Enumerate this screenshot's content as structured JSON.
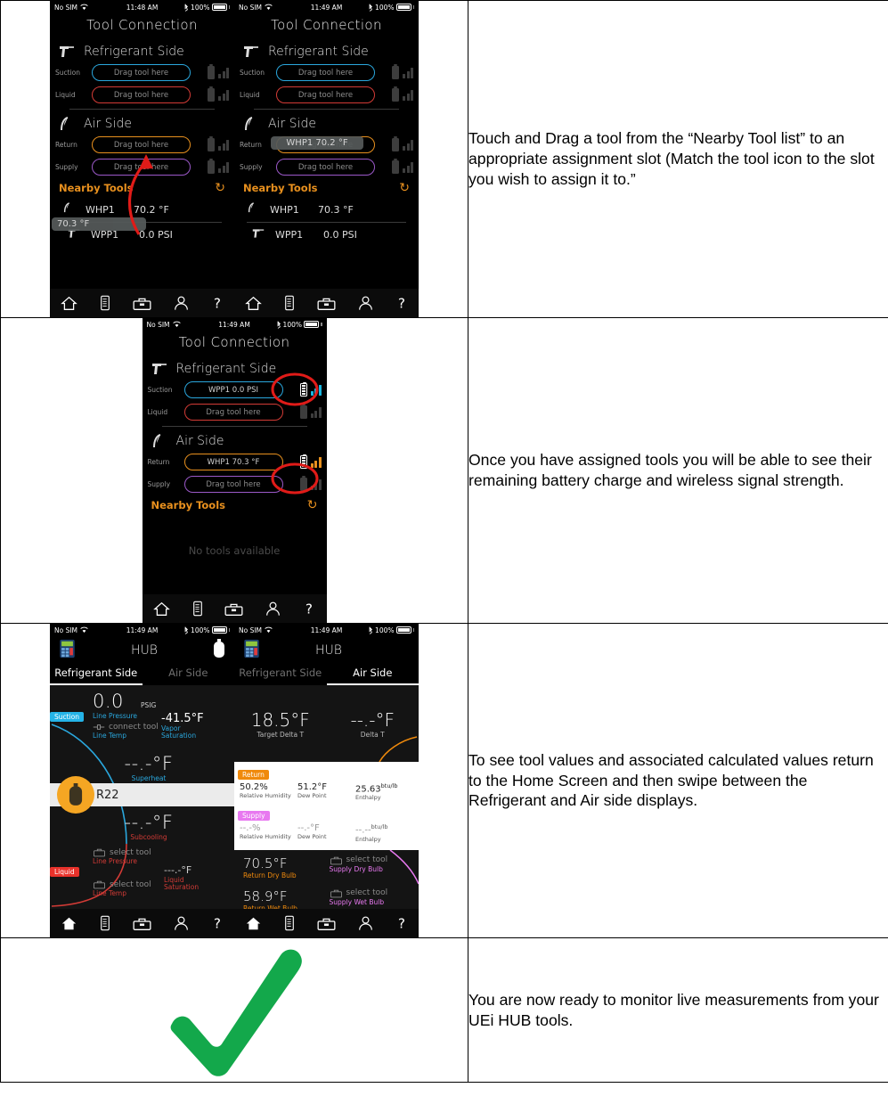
{
  "document": {
    "rows": [
      {
        "caption": "Touch and Drag a tool from the “Nearby Tool list” to an appropriate assignment slot (Match the tool icon to the slot you wish to assign it to.”"
      },
      {
        "caption": "Once you have assigned tools you will be able to see their remaining battery charge and wireless signal strength."
      },
      {
        "caption": "To see tool values and associated calculated values return to the Home Screen and then swipe between the Refrigerant and Air side displays."
      },
      {
        "caption": "You are now ready to monitor live measurements from your UEi HUB tools."
      }
    ]
  },
  "screens": {
    "tool_connection_drag": {
      "status": {
        "carrier": "No SIM",
        "wifi_icon": "wifi-icon",
        "time": "11:48 AM",
        "bluetooth_icon": "bluetooth-icon",
        "battery_pct": "100%"
      },
      "nav_title": "Tool Connection",
      "refrigerant": {
        "heading": "Refrigerant Side",
        "icon": "pressure-probe-icon",
        "slots": [
          {
            "label": "Suction",
            "value": "Drag tool here",
            "color": "#2aa7dd",
            "filled": false
          },
          {
            "label": "Liquid",
            "value": "Drag tool here",
            "color": "#d33b36",
            "filled": false
          }
        ]
      },
      "air": {
        "heading": "Air Side",
        "icon": "air-probe-icon",
        "slots": [
          {
            "label": "Return",
            "value": "Drag tool here",
            "color": "#e8901e",
            "filled": false
          },
          {
            "label": "Supply",
            "value": "Drag tool here",
            "color": "#9b59c9",
            "filled": false
          }
        ]
      },
      "nearby": {
        "title": "Nearby Tools",
        "refresh_icon": "refresh-icon",
        "tools": [
          {
            "icon": "air-probe-icon",
            "name": "WHP1",
            "value": "70.2 °F"
          },
          {
            "icon": "pressure-probe-icon",
            "name": "WPP1",
            "value": "0.0 PSI"
          }
        ]
      },
      "drag_ghost": {
        "value": "70.3 °F",
        "icon": "air-probe-icon"
      },
      "annotation": {
        "type": "red-arrow",
        "color": "#e01b18"
      },
      "tabbar": [
        "home-icon",
        "gauge-icon",
        "toolbox-icon",
        "account-icon",
        "help-icon"
      ]
    },
    "tool_connection_drop": {
      "status": {
        "carrier": "No SIM",
        "wifi_icon": "wifi-icon",
        "time": "11:49 AM",
        "bluetooth_icon": "bluetooth-icon",
        "battery_pct": "100%"
      },
      "nav_title": "Tool Connection",
      "refrigerant": {
        "heading": "Refrigerant Side",
        "icon": "pressure-probe-icon",
        "slots": [
          {
            "label": "Suction",
            "value": "Drag tool here",
            "color": "#2aa7dd",
            "filled": false
          },
          {
            "label": "Liquid",
            "value": "Drag tool here",
            "color": "#d33b36",
            "filled": false
          }
        ]
      },
      "air": {
        "heading": "Air Side",
        "icon": "air-probe-icon",
        "slots": [
          {
            "label": "Return",
            "value": "Drag tool here",
            "overlay": "WHP1 70.2 °F",
            "color": "#e8901e",
            "filled": true
          },
          {
            "label": "Supply",
            "value": "Drag tool here",
            "color": "#9b59c9",
            "filled": false
          }
        ]
      },
      "nearby": {
        "title": "Nearby Tools",
        "refresh_icon": "refresh-icon",
        "tools": [
          {
            "icon": "air-probe-icon",
            "name": "WHP1",
            "value": "70.3 °F"
          },
          {
            "icon": "pressure-probe-icon",
            "name": "WPP1",
            "value": "0.0 PSI"
          }
        ]
      },
      "tabbar": [
        "home-icon",
        "gauge-icon",
        "toolbox-icon",
        "account-icon",
        "help-icon"
      ]
    },
    "tool_connection_assigned": {
      "status": {
        "carrier": "No SIM",
        "wifi_icon": "wifi-icon",
        "time": "11:49 AM",
        "bluetooth_icon": "bluetooth-icon",
        "battery_pct": "100%"
      },
      "nav_title": "Tool Connection",
      "refrigerant": {
        "heading": "Refrigerant Side",
        "icon": "pressure-probe-icon",
        "slots": [
          {
            "label": "Suction",
            "value": "WPP1  0.0 PSI",
            "color": "#2aa7dd",
            "filled": true,
            "battery": true,
            "signal": "cyan"
          },
          {
            "label": "Liquid",
            "value": "Drag tool here",
            "color": "#d33b36",
            "filled": false,
            "battery": false,
            "signal": "off"
          }
        ]
      },
      "air": {
        "heading": "Air Side",
        "icon": "air-probe-icon",
        "slots": [
          {
            "label": "Return",
            "value": "WHP1  70.3 °F",
            "color": "#e8901e",
            "filled": true,
            "battery": true,
            "signal": "orange"
          },
          {
            "label": "Supply",
            "value": "Drag tool here",
            "color": "#9b59c9",
            "filled": false,
            "battery": false,
            "signal": "off"
          }
        ]
      },
      "nearby": {
        "title": "Nearby Tools",
        "refresh_icon": "refresh-icon",
        "empty_text": "No tools available",
        "tools": []
      },
      "annotation": {
        "type": "red-circles",
        "color": "#e01b18"
      },
      "tabbar": [
        "home-icon",
        "gauge-icon",
        "toolbox-icon",
        "account-icon",
        "help-icon"
      ]
    },
    "hub_refrigerant": {
      "status": {
        "carrier": "No SIM",
        "wifi_icon": "wifi-icon",
        "time": "11:49 AM",
        "bluetooth_icon": "bluetooth-icon",
        "battery_pct": "100%"
      },
      "header": {
        "left_icon": "manifold-icon",
        "title": "HUB",
        "right_icon": "tank-icon"
      },
      "tabs": [
        {
          "label": "Refrigerant Side",
          "active": true
        },
        {
          "label": "Air Side",
          "active": false
        }
      ],
      "suction_tag": "Suction",
      "liquid_tag": "Liquid",
      "refrigerant_label": "R22",
      "readouts": [
        {
          "value": "0.0",
          "unit": "PSIG",
          "label": "Line Pressure",
          "color": "#2aa7dd"
        },
        {
          "value": "-41.5°F",
          "label": "Vapor Saturation",
          "color": "#2aa7dd"
        },
        {
          "value": "connect tool",
          "label": "Line Temp",
          "color": "#2aa7dd",
          "placeholder": true
        },
        {
          "value": "--.-°F",
          "label": "Superheat",
          "color": "#2aa7dd"
        },
        {
          "value": "--.-°F",
          "label": "Subcooling",
          "color": "#d33b36"
        },
        {
          "value": "select tool",
          "label": "Line Pressure",
          "color": "#d33b36",
          "placeholder": true
        },
        {
          "value": "---.-°F",
          "label": "Liquid Saturation",
          "color": "#d33b36"
        },
        {
          "value": "select tool",
          "label": "Line Temp",
          "color": "#d33b36",
          "placeholder": true
        }
      ],
      "tabbar": [
        "home-icon",
        "gauge-icon",
        "toolbox-icon",
        "account-icon",
        "help-icon"
      ]
    },
    "hub_air": {
      "status": {
        "carrier": "No SIM",
        "wifi_icon": "wifi-icon",
        "time": "11:49 AM",
        "bluetooth_icon": "bluetooth-icon",
        "battery_pct": "100%"
      },
      "header": {
        "left_icon": "manifold-icon",
        "title": "HUB",
        "right_icon": ""
      },
      "tabs": [
        {
          "label": "Refrigerant Side",
          "active": false
        },
        {
          "label": "Air Side",
          "active": true
        }
      ],
      "delta": [
        {
          "value": "18.5°F",
          "label": "Target Delta T"
        },
        {
          "value": "--.-°F",
          "label": "Delta T"
        }
      ],
      "return_tag": "Return",
      "return_row": [
        {
          "value": "50.2%",
          "label": "Relative Humidity"
        },
        {
          "value": "51.2°F",
          "label": "Dew Point"
        },
        {
          "value": "25.63",
          "unit": "btu/lb",
          "label": "Enthalpy"
        }
      ],
      "supply_tag": "Supply",
      "supply_row": [
        {
          "value": "--.-%",
          "label": "Relative Humidity"
        },
        {
          "value": "--.-°F",
          "label": "Dew Point"
        },
        {
          "value": "--.--",
          "unit": "btu/lb",
          "label": "Enthalpy"
        }
      ],
      "bulbs": [
        {
          "value": "70.5°F",
          "label": "Return Dry Bulb",
          "color": "#f08a0c"
        },
        {
          "value": "select tool",
          "label": "Supply Dry Bulb",
          "color": "#e879f0",
          "placeholder": true
        },
        {
          "value": "58.9°F",
          "label": "Return Wet Bulb",
          "color": "#f08a0c"
        },
        {
          "value": "select tool",
          "label": "Supply Wet Bulb",
          "color": "#e879f0",
          "placeholder": true
        }
      ],
      "tabbar": [
        "home-icon",
        "gauge-icon",
        "toolbox-icon",
        "account-icon",
        "help-icon"
      ]
    },
    "checkmark": {
      "icon": "green-checkmark-icon",
      "color": "#13a84b"
    }
  }
}
